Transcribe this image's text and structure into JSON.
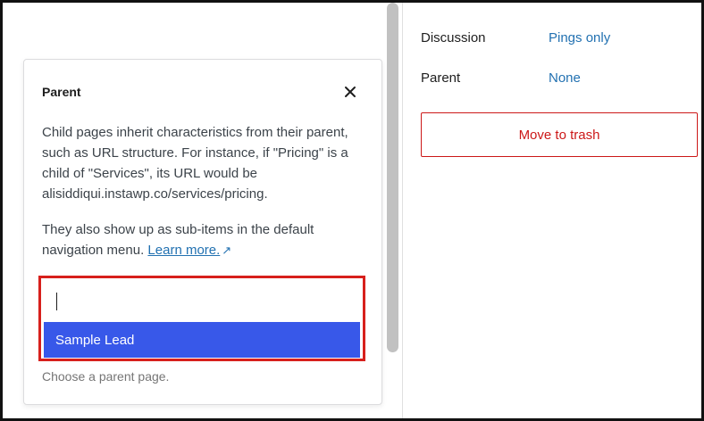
{
  "popover": {
    "title": "Parent",
    "description_1": "Child pages inherit characteristics from their parent, such as URL structure. For instance, if \"Pricing\" is a child of \"Services\", its URL would be alisiddiqui.instawp.co/services/pricing.",
    "description_2_prefix": "They also show up as sub-items in the default navigation menu. ",
    "learn_more": "Learn more.",
    "ext_arrow": "↗",
    "input_value": "",
    "suggestion": "Sample Lead",
    "help_text": "Choose a parent page."
  },
  "sidebar": {
    "rows": [
      {
        "label": "Discussion",
        "value": "Pings only"
      },
      {
        "label": "Parent",
        "value": "None"
      }
    ],
    "trash_button": "Move to trash"
  },
  "colors": {
    "accent": "#3858e9",
    "link": "#2271b1",
    "danger": "#cc1818",
    "highlight": "#d7201c"
  },
  "icons": {
    "close": "close-icon",
    "external": "external-link-icon"
  }
}
